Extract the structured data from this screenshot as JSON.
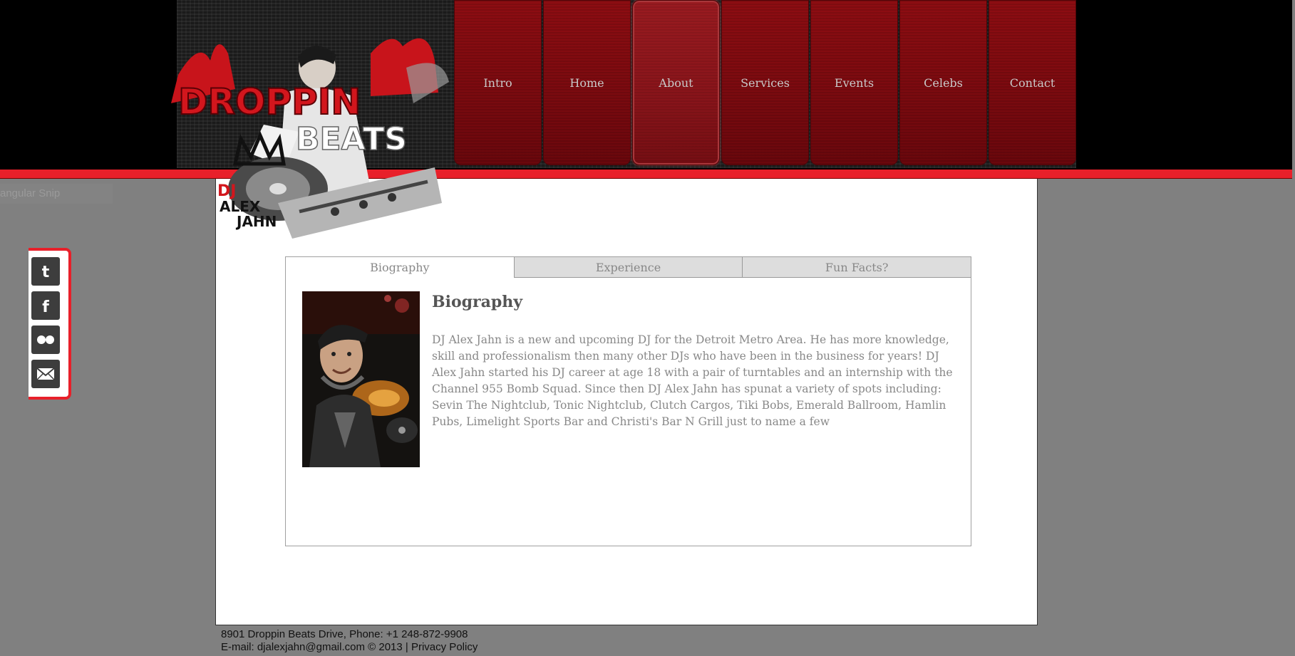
{
  "nav": {
    "items": [
      {
        "label": "Intro"
      },
      {
        "label": "Home"
      },
      {
        "label": "About"
      },
      {
        "label": "Services"
      },
      {
        "label": "Events"
      },
      {
        "label": "Celebs"
      },
      {
        "label": "Contact"
      }
    ],
    "active": "About"
  },
  "logo": {
    "line1": "DROPPIN",
    "line2": "BEATS",
    "dj_line1": "DJ",
    "dj_line2": "ALEX",
    "dj_line3": "JAHN"
  },
  "ghost_label": "angular Snip",
  "social": {
    "items": [
      {
        "icon": "twitter-icon",
        "glyph": "t"
      },
      {
        "icon": "facebook-icon",
        "glyph": "f"
      },
      {
        "icon": "flickr-icon",
        "glyph": "●●"
      },
      {
        "icon": "email-icon",
        "glyph": "✉"
      }
    ]
  },
  "tabs": {
    "items": [
      {
        "label": "Biography"
      },
      {
        "label": "Experience"
      },
      {
        "label": "Fun Facts?"
      }
    ],
    "active": "Biography"
  },
  "bio": {
    "title": "Biography",
    "text": "DJ Alex Jahn is a new and upcoming DJ for the Detroit Metro Area. He has more knowledge, skill and professionalism then many other DJs who have been in the business for years! DJ Alex Jahn started his DJ career at age 18 with a pair of turntables and an internship with the Channel 955 Bomb Squad. Since then DJ Alex Jahn has spunat a variety of spots including: Sevin The Nightclub, Tonic Nightclub, Clutch Cargos, Tiki Bobs, Emerald Ballroom, Hamlin Pubs, Limelight Sports Bar and Christi's Bar N Grill just to name a few"
  },
  "footer": {
    "address": "8901 Droppin Beats Drive, Phone: +1 248-872-9908",
    "email_prefix": "E-mail: djalexjahn@gmail.com © 2013 |",
    "privacy": "Privacy Policy"
  },
  "colors": {
    "accent_red": "#e8202a",
    "nav_red": "#7a0a0f",
    "background_gray": "#808080"
  }
}
